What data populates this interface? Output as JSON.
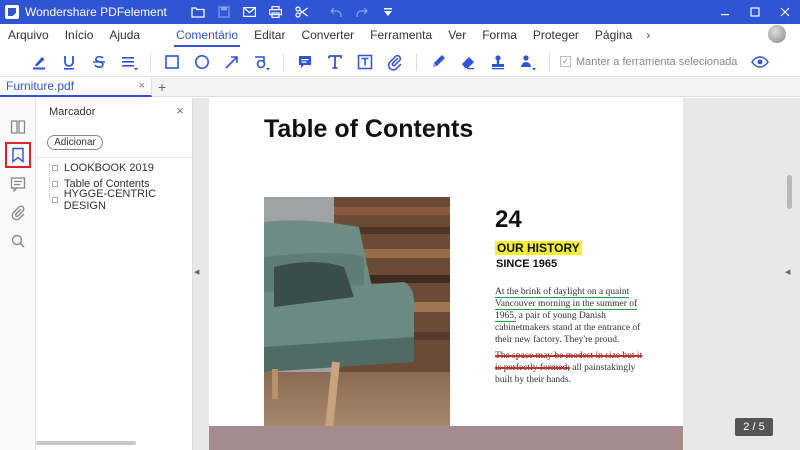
{
  "titlebar": {
    "app_name": "Wondershare PDFelement",
    "icons": [
      "folder-icon",
      "save-icon",
      "mail-icon",
      "print-icon",
      "scissors-icon",
      "undo-icon",
      "redo-icon",
      "dropdown-icon"
    ],
    "window_controls": [
      "minimize",
      "maximize",
      "close"
    ]
  },
  "menu": {
    "items": [
      "Arquivo",
      "Início",
      "Ajuda",
      "Comentário",
      "Editar",
      "Converter",
      "Ferramenta",
      "Ver",
      "Forma",
      "Proteger",
      "Página"
    ],
    "active": "Comentário",
    "more": "›"
  },
  "toolbar": {
    "keep_tool_label": "Manter a ferramenta selecionada"
  },
  "tabs": {
    "file_name": "Furniture.pdf",
    "close": "×",
    "add": "+"
  },
  "bookmark_panel": {
    "title": "Marcador",
    "close": "×",
    "add_button": "Adicionar",
    "items": [
      "LOOKBOOK 2019",
      "Table of Contents",
      "HYGGE-CENTRIC DESIGN"
    ]
  },
  "document": {
    "heading": "Table of Contents",
    "number": "24",
    "history": "OUR HISTORY",
    "since": "SINCE 1965",
    "para1_underlined": "At the brink of daylight on a quaint Vancouver morning in the summer of 1965,",
    "para1_rest": " a pair of young Danish cabinetmakers stand at the entrance of their new factory. They're proud.",
    "para2_struck": "The space may be modest in size but it is perfectly formed;",
    "para2_rest": " all painstakingly built by their hands."
  },
  "status": {
    "page_indicator": "2 / 5"
  },
  "colors": {
    "brand": "#2f55d4",
    "highlight": "#f4ef33",
    "underline": "#2e9a45",
    "strikeout": "#d02a2a",
    "active_rail_border": "#d9232d"
  }
}
